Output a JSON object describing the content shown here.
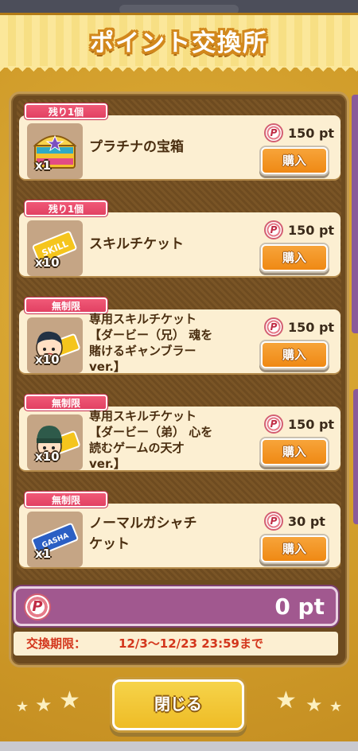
{
  "header": {
    "title": "ポイント交換所"
  },
  "items": [
    {
      "tag": "残り1個",
      "name": "プラチナの宝箱",
      "qty": "x1",
      "price": "150 pt",
      "buy_label": "購入",
      "icon": "treasure-chest-icon"
    },
    {
      "tag": "残り1個",
      "name": "スキルチケット",
      "qty": "x10",
      "price": "150 pt",
      "buy_label": "購入",
      "icon": "skill-ticket-icon",
      "ticket_text": "SKILL"
    },
    {
      "tag": "無制限",
      "name_lines": [
        "専用スキルチケット",
        "【ダービー（兄） 魂を",
        "賭けるギャンブラー",
        "ver.】"
      ],
      "qty": "x10",
      "price": "150 pt",
      "buy_label": "購入",
      "icon": "character-ticket-icon"
    },
    {
      "tag": "無制限",
      "name_lines": [
        "専用スキルチケット",
        "【ダービー（弟） 心を",
        "読むゲームの天才",
        "ver.】"
      ],
      "qty": "x10",
      "price": "150 pt",
      "buy_label": "購入",
      "icon": "character-ticket-icon"
    },
    {
      "tag": "無制限",
      "name_lines": [
        "ノーマルガシャチ",
        "ケット"
      ],
      "qty": "x1",
      "price": "30 pt",
      "buy_label": "購入",
      "icon": "gasha-ticket-icon",
      "ticket_text": "GASHA"
    }
  ],
  "points": {
    "coin": "P",
    "value": "0 pt"
  },
  "period": {
    "label": "交換期限：",
    "value": "12/3〜12/23 23:59まで"
  },
  "close_label": "閉じる",
  "price_coin": "P"
}
